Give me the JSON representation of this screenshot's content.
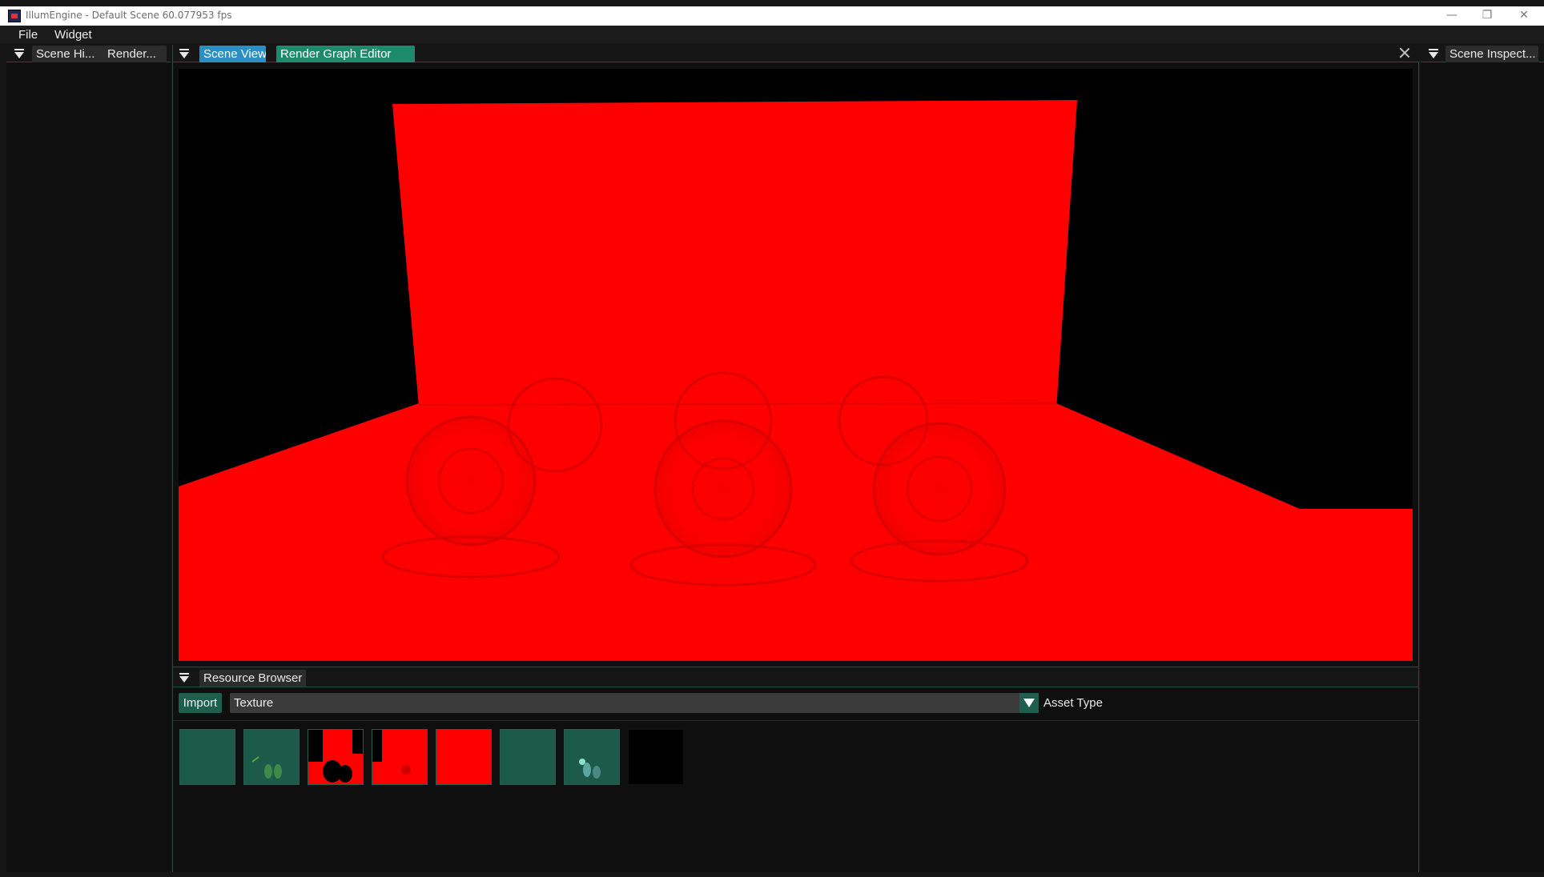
{
  "window": {
    "title": "IllumEngine - Default Scene 60.077953 fps",
    "controls": {
      "minimize": "—",
      "restore": "❐",
      "close": "✕"
    }
  },
  "menu": {
    "items": [
      "File",
      "Widget"
    ]
  },
  "left_panel": {
    "tabs": [
      "Scene Hi...",
      "Render..."
    ]
  },
  "center_panel": {
    "tabs": [
      "Scene View",
      "Render Graph Editor"
    ]
  },
  "right_panel": {
    "tabs": [
      "Scene Inspect..."
    ]
  },
  "resource_browser": {
    "tab": "Resource Browser",
    "import_label": "Import",
    "asset_type_value": "Texture",
    "asset_type_label": "Asset Type",
    "thumbnails": [
      {
        "name": "texture-thumb-1",
        "color": "#1d5a49"
      },
      {
        "name": "texture-thumb-2",
        "color": "#1d5a49"
      },
      {
        "name": "texture-thumb-3",
        "color": "#ff0000"
      },
      {
        "name": "texture-thumb-4",
        "color": "#ff0000"
      },
      {
        "name": "texture-thumb-5",
        "color": "#ff0000"
      },
      {
        "name": "texture-thumb-6",
        "color": "#1d5a49"
      },
      {
        "name": "texture-thumb-7",
        "color": "#1d5a49"
      },
      {
        "name": "texture-thumb-8",
        "color": "#000000"
      }
    ]
  },
  "colors": {
    "accent_blue": "#2a8fc4",
    "accent_green": "#1e8a6c",
    "scene_red": "#ff0000",
    "panel_bg": "#0f0f0f"
  }
}
